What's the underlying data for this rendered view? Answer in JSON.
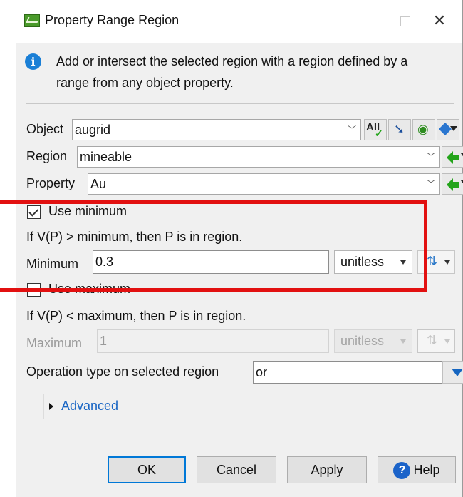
{
  "window": {
    "title": "Property Range Region",
    "minimize_label": "",
    "close_symbol": "✕"
  },
  "info": {
    "text": "Add or intersect the selected region with a region defined by a range from any object property."
  },
  "object": {
    "label": "Object",
    "value": "augrid",
    "all_label": "All"
  },
  "region": {
    "label": "Region",
    "value": "mineable"
  },
  "property": {
    "label": "Property",
    "value": "Au"
  },
  "minimum": {
    "checkbox_label": "Use minimum",
    "checked": true,
    "rule": "If V(P) > minimum, then P is in region.",
    "label": "Minimum",
    "value": "0.3",
    "unit": "unitless"
  },
  "maximum": {
    "checkbox_label": "Use maximum",
    "checked": false,
    "rule": "If V(P) < maximum, then P is in region.",
    "label": "Maximum",
    "value": "1",
    "unit": "unitless"
  },
  "operation": {
    "label": "Operation type on selected region",
    "value": "or"
  },
  "advanced": {
    "label": "Advanced"
  },
  "buttons": {
    "ok": "OK",
    "cancel": "Cancel",
    "apply": "Apply",
    "help": "Help"
  },
  "colors": {
    "highlight": "#e21010",
    "accent": "#0078d7",
    "link": "#1a66c4"
  }
}
